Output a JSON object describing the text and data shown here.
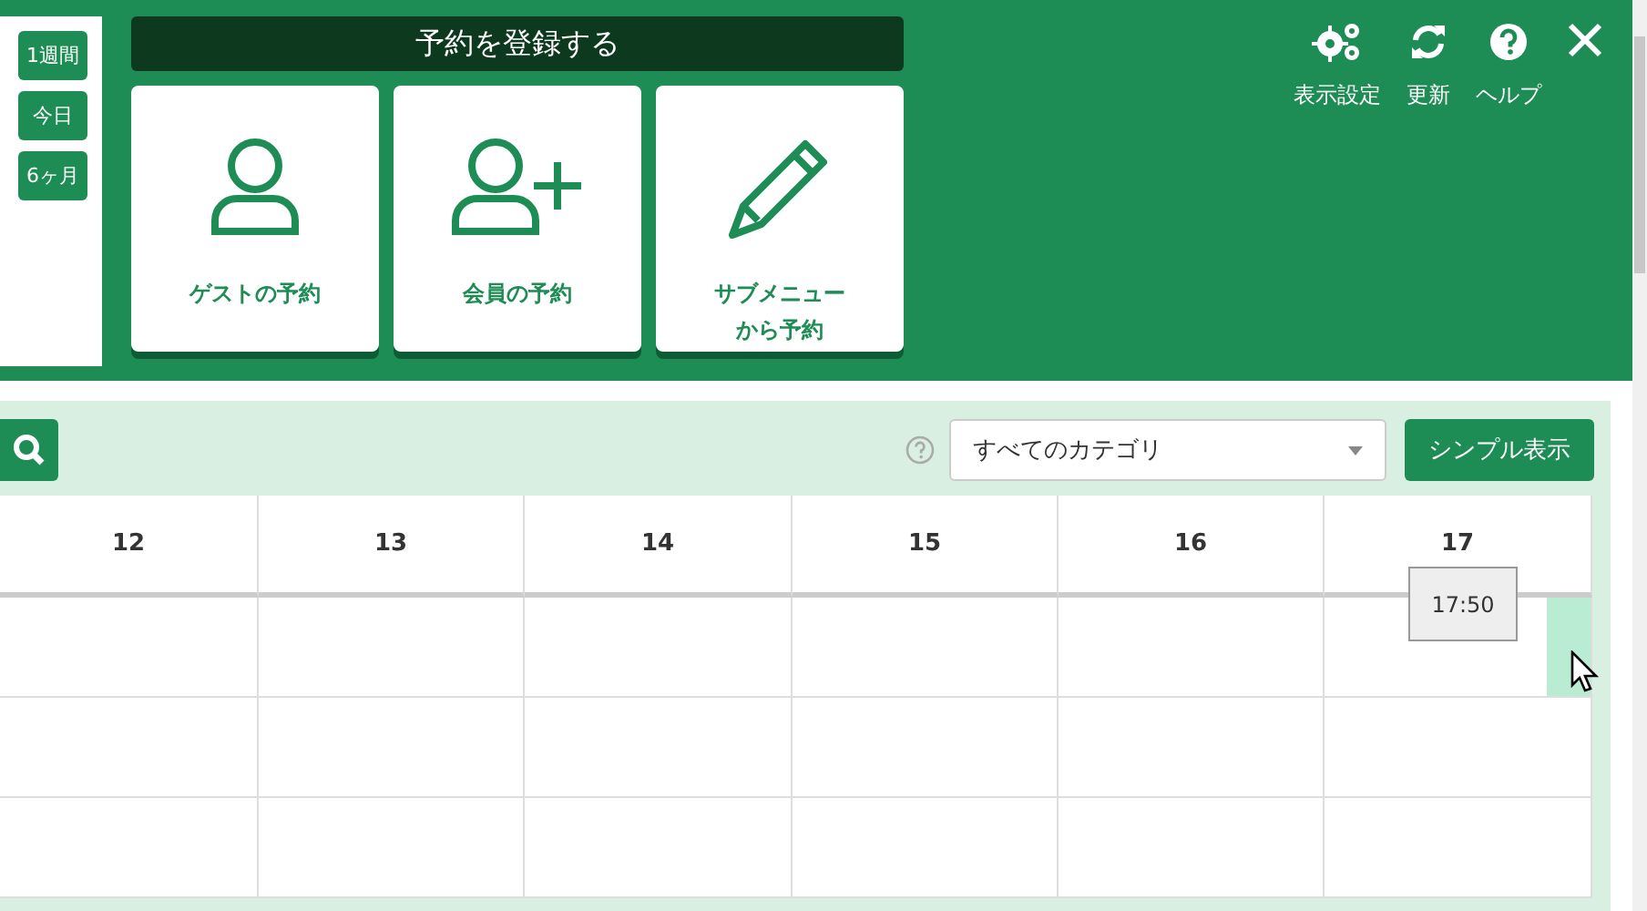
{
  "view_buttons": [
    {
      "label": "1週間"
    },
    {
      "label": "今日"
    },
    {
      "label": "6ヶ月"
    }
  ],
  "register": {
    "title": "予約を登録する",
    "cards": [
      {
        "kind": "person",
        "label": "ゲストの予約"
      },
      {
        "kind": "person-add",
        "label": "会員の予約"
      },
      {
        "kind": "pencil",
        "label": "サブメニューから予約"
      }
    ]
  },
  "header_actions": [
    {
      "kind": "gears",
      "label": "表示設定"
    },
    {
      "kind": "refresh",
      "label": "更新"
    },
    {
      "kind": "help",
      "label": "ヘルプ"
    },
    {
      "kind": "close"
    }
  ],
  "toolbar": {
    "category_select": "すべてのカテゴリ",
    "simple_button": "シンプル表示"
  },
  "calendar": {
    "columns": [
      "12",
      "13",
      "14",
      "15",
      "16",
      "17"
    ],
    "time_tooltip": "17:50"
  }
}
